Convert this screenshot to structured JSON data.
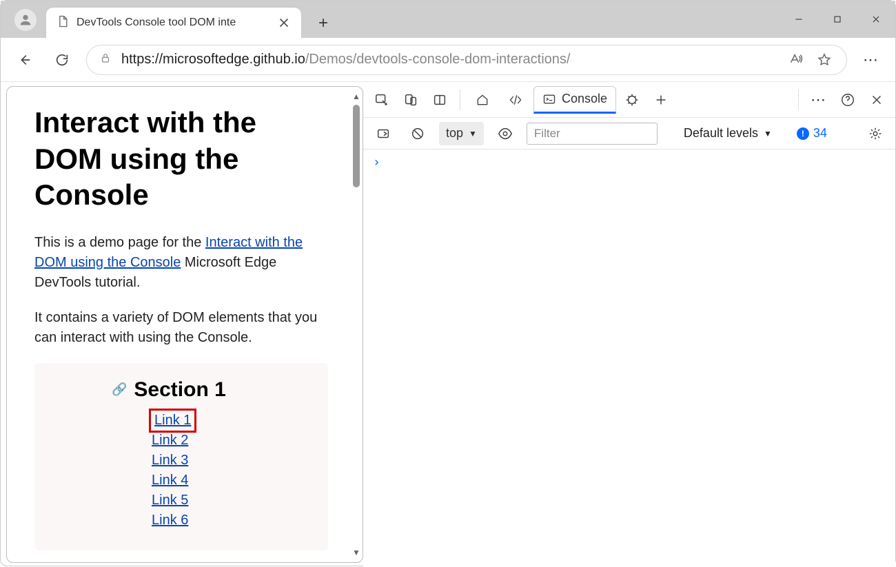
{
  "window": {
    "tab_title": "DevTools Console tool DOM inte"
  },
  "toolbar": {
    "url_host": "https://microsoftedge.github.io",
    "url_path": "/Demos/devtools-console-dom-interactions/"
  },
  "page": {
    "heading": "Interact with the DOM using the Console",
    "intro_before": "This is a demo page for the ",
    "intro_link": "Interact with the DOM using the Console",
    "intro_after": " Microsoft Edge DevTools tutorial.",
    "para2": "It contains a variety of DOM elements that you can interact with using the Console.",
    "section_title": "Section 1",
    "links": [
      "Link 1",
      "Link 2",
      "Link 3",
      "Link 4",
      "Link 5",
      "Link 6"
    ]
  },
  "devtools": {
    "active_tab": "Console",
    "context": "top",
    "filter_placeholder": "Filter",
    "levels_label": "Default levels",
    "issue_count": "34"
  }
}
